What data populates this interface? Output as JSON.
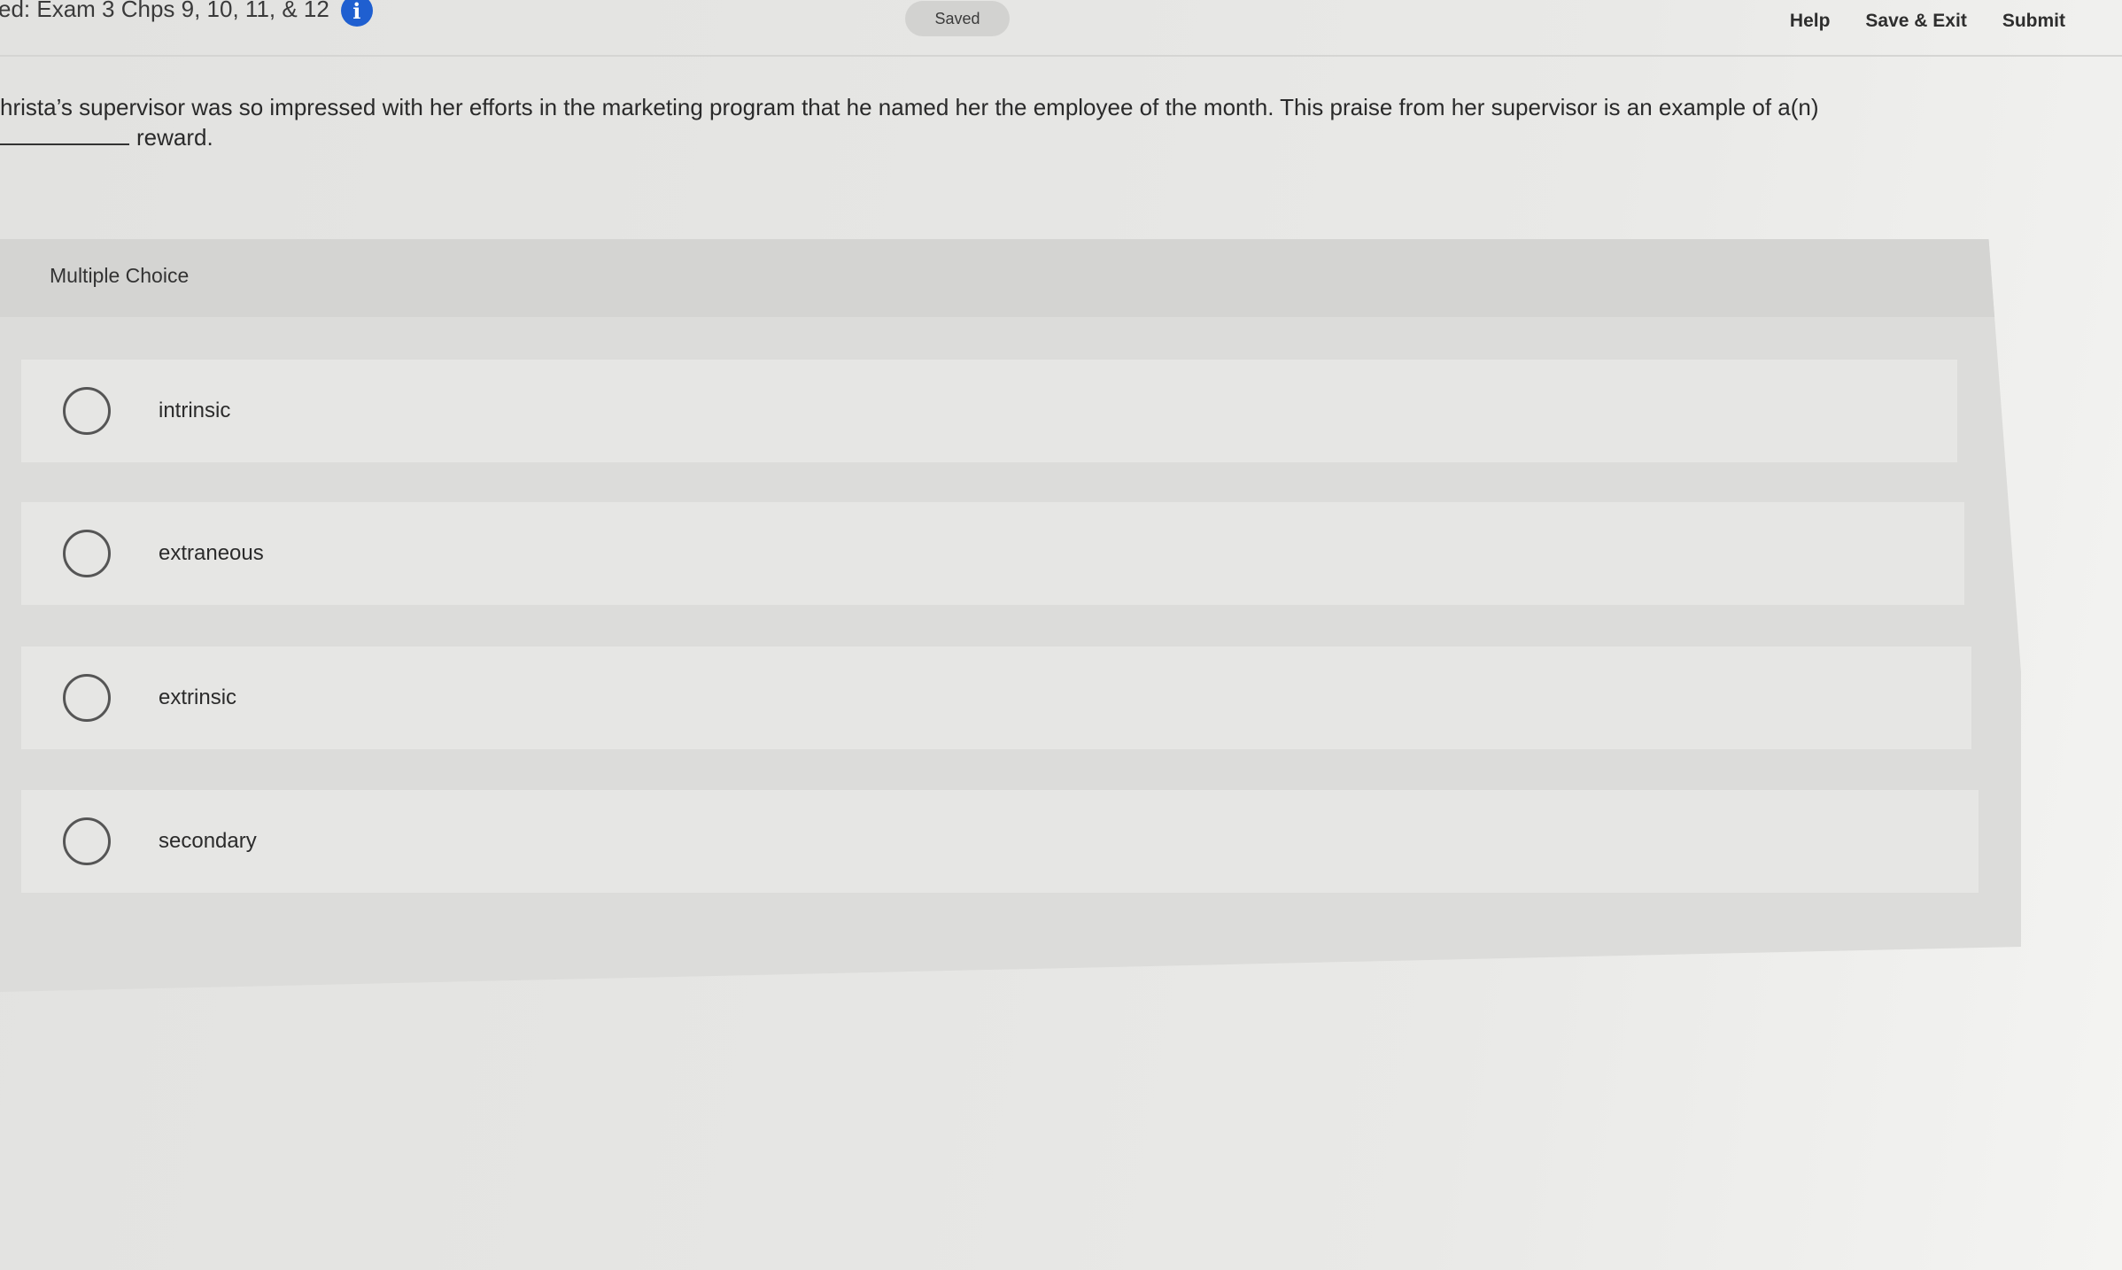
{
  "header": {
    "exam_title": "ed: Exam 3 Chps 9, 10, 11, & 12",
    "info_icon": "info-icon",
    "status": "Saved",
    "links": {
      "help": "Help",
      "save_exit": "Save & Exit",
      "submit": "Submit"
    }
  },
  "question": {
    "text": "hrista’s supervisor was so impressed with her efforts in the marketing program that he named her the employee of the month. This praise from her supervisor is an example of a(n)",
    "suffix": "reward."
  },
  "choice_block": {
    "label": "Multiple Choice",
    "options": [
      {
        "label": "intrinsic"
      },
      {
        "label": "extraneous"
      },
      {
        "label": "extrinsic"
      },
      {
        "label": "secondary"
      }
    ]
  },
  "colors": {
    "accent": "#1f5fd0",
    "panel": "#dcdcda",
    "option_bg": "#e6e6e4"
  }
}
